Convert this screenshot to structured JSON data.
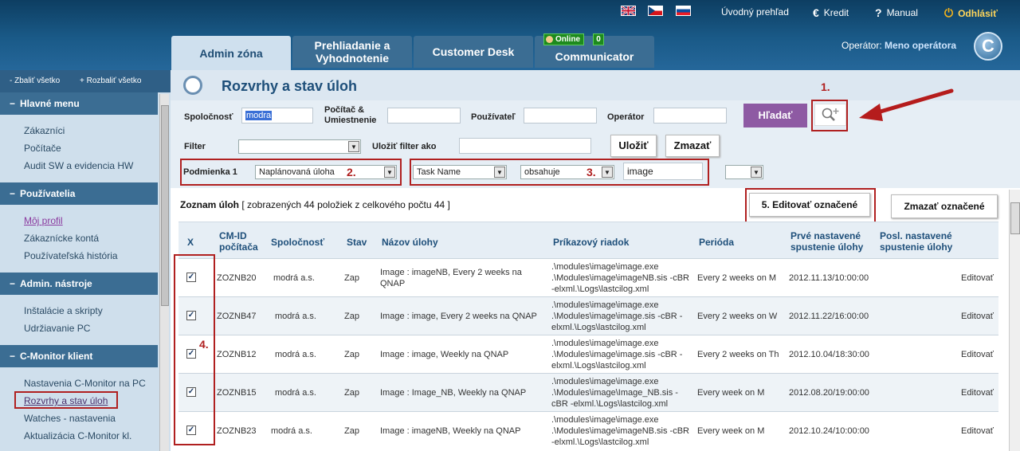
{
  "top_links": {
    "home": "Úvodný prehľad",
    "credit": "Kredit",
    "manual": "Manual",
    "logout": "Odhlásiť"
  },
  "tabs": [
    {
      "label": "Admin zóna"
    },
    {
      "label": "Prehliadanie a Vyhodnotenie"
    },
    {
      "label": "Customer Desk"
    },
    {
      "label": "Communicator",
      "status": "Online",
      "count": "0"
    }
  ],
  "operator": {
    "label": "Operátor:",
    "name": "Meno operátora"
  },
  "sidebar": {
    "collapse_all": "- Zbaliť všetko",
    "expand_all": "+ Rozbaliť všetko",
    "sections": [
      {
        "title": "Hlavné menu",
        "items": [
          "Zákazníci",
          "Počítače",
          "Audit SW a evidencia HW"
        ]
      },
      {
        "title": "Používatelia",
        "items": [
          "Môj profil",
          "Zákaznícke kontá",
          "Používateľská história"
        ]
      },
      {
        "title": "Admin. nástroje",
        "items": [
          "Inštalácie a skripty",
          "Udržiavanie PC"
        ]
      },
      {
        "title": "C-Monitor klient",
        "items": [
          "Nastavenia C-Monitor na PC",
          "Rozvrhy a stav úloh",
          "Watches - nastavenia",
          "Aktualizácia C-Monitor kl."
        ]
      }
    ]
  },
  "page": {
    "title": "Rozvrhy a stav úloh"
  },
  "filters": {
    "company_label": "Spoločnosť",
    "company_value": "modra",
    "computer_label": "Počítač & Umiestnenie",
    "user_label": "Používateľ",
    "operator_label": "Operátor",
    "search_button": "Hľadať",
    "filter_label": "Filter",
    "save_filter_label": "Uložiť filter ako",
    "save_button": "Uložiť",
    "delete_button": "Zmazať",
    "condition_label": "Podmienka 1",
    "condition_value": "Naplánovaná úloha",
    "field_value": "Task Name",
    "operator_value": "obsahuje",
    "text_value": "image"
  },
  "annotations": {
    "n1": "1.",
    "n2": "2.",
    "n3": "3.",
    "n4": "4."
  },
  "list": {
    "prefix": "Zoznam úloh",
    "summary": "[ zobrazených 44 položiek z celkového počtu 44 ]",
    "edit_selected": "5. Editovať označené",
    "delete_selected": "Zmazať označené"
  },
  "table": {
    "headers": [
      "X",
      "CM-ID počítača",
      "Spoločnosť",
      "Stav",
      "Názov úlohy",
      "Príkazový riadok",
      "Perióda",
      "Prvé nastavené spustenie úlohy",
      "Posl. nastavené spustenie úlohy"
    ],
    "edit_label": "Editovať",
    "rows": [
      {
        "id": "ZOZNB20",
        "company": "modrá a.s.",
        "state": "Zap",
        "name": "Image : imageNB, Every 2 weeks na QNAP",
        "cmd": ".\\modules\\image\\image.exe .\\Modules\\image\\imageNB.sis -cBR -elxml.\\Logs\\lastcilog.xml",
        "period": "Every 2 weeks on M",
        "first": "2012.11.13/10:00:00"
      },
      {
        "id": "ZOZNB47",
        "company": "modrá a.s.",
        "state": "Zap",
        "name": "Image : image, Every 2 weeks na QNAP",
        "cmd": ".\\modules\\image\\image.exe .\\Modules\\image\\image.sis -cBR -elxml.\\Logs\\lastcilog.xml",
        "period": "Every 2 weeks on W",
        "first": "2012.11.22/16:00:00"
      },
      {
        "id": "ZOZNB12",
        "company": "modrá a.s.",
        "state": "Zap",
        "name": "Image : image, Weekly na QNAP",
        "cmd": ".\\modules\\image\\image.exe .\\Modules\\image\\image.sis -cBR -elxml.\\Logs\\lastcilog.xml",
        "period": "Every 2 weeks on Th",
        "first": "2012.10.04/18:30:00"
      },
      {
        "id": "ZOZNB15",
        "company": "modrá a.s.",
        "state": "Zap",
        "name": "Image : Image_NB, Weekly na QNAP",
        "cmd": ".\\modules\\image\\image.exe .\\Modules\\image\\Image_NB.sis -cBR -elxml.\\Logs\\lastcilog.xml",
        "period": "Every week on M",
        "first": "2012.08.20/19:00:00"
      },
      {
        "id": "ZOZNB23",
        "company": "modrá a.s.",
        "state": "Zap",
        "name": "Image : imageNB, Weekly na QNAP",
        "cmd": ".\\modules\\image\\image.exe .\\Modules\\image\\imageNB.sis -cBR -elxml.\\Logs\\lastcilog.xml",
        "period": "Every week on M",
        "first": "2012.10.24/10:00:00"
      }
    ]
  }
}
